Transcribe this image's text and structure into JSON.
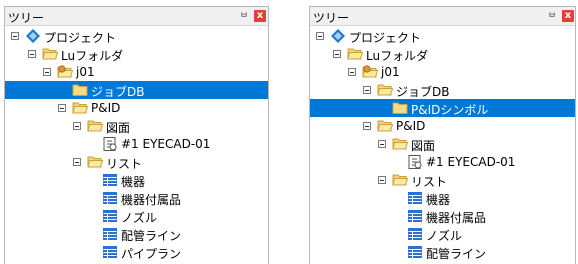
{
  "panels": [
    {
      "title": "ツリー",
      "pin_glyph": "ㅂ",
      "close_glyph": "x",
      "items": [
        {
          "label": "プロジェクト",
          "icon": "project-icon",
          "expander": true
        },
        {
          "label": "Luフォルダ",
          "icon": "folder-open-icon",
          "expander": true
        },
        {
          "label": "j01",
          "icon": "job-folder-icon",
          "expander": true
        },
        {
          "label": "ジョブDB",
          "icon": "folder-closed-icon",
          "expander": false,
          "selected": true
        },
        {
          "label": "P&ID",
          "icon": "folder-open-icon",
          "expander": true
        },
        {
          "label": "図面",
          "icon": "folder-open-icon",
          "expander": true
        },
        {
          "label": "#1 EYECAD-01",
          "icon": "drawing-icon",
          "expander": false
        },
        {
          "label": "リスト",
          "icon": "folder-open-icon",
          "expander": true
        },
        {
          "label": "機器",
          "icon": "table-icon",
          "expander": false
        },
        {
          "label": "機器付属品",
          "icon": "table-icon",
          "expander": false
        },
        {
          "label": "ノズル",
          "icon": "table-icon",
          "expander": false
        },
        {
          "label": "配管ライン",
          "icon": "table-icon",
          "expander": false
        },
        {
          "label": "パイプラン",
          "icon": "table-icon",
          "expander": false
        }
      ]
    },
    {
      "title": "ツリー",
      "pin_glyph": "ㅂ",
      "close_glyph": "x",
      "items": [
        {
          "label": "プロジェクト",
          "icon": "project-icon",
          "expander": true
        },
        {
          "label": "Luフォルダ",
          "icon": "folder-open-icon",
          "expander": true
        },
        {
          "label": "j01",
          "icon": "job-folder-icon",
          "expander": true
        },
        {
          "label": "ジョブDB",
          "icon": "folder-open-icon",
          "expander": true
        },
        {
          "label": "P&IDシンボル",
          "icon": "folder-closed-icon",
          "expander": false,
          "selected": true
        },
        {
          "label": "P&ID",
          "icon": "folder-open-icon",
          "expander": true
        },
        {
          "label": "図面",
          "icon": "folder-open-icon",
          "expander": true
        },
        {
          "label": "#1 EYECAD-01",
          "icon": "drawing-icon",
          "expander": false
        },
        {
          "label": "リスト",
          "icon": "folder-open-icon",
          "expander": true
        },
        {
          "label": "機器",
          "icon": "table-icon",
          "expander": false
        },
        {
          "label": "機器付属品",
          "icon": "table-icon",
          "expander": false
        },
        {
          "label": "ノズル",
          "icon": "table-icon",
          "expander": false
        },
        {
          "label": "配管ライン",
          "icon": "table-icon",
          "expander": false
        }
      ]
    }
  ],
  "colors": {
    "selection": "#0078d7",
    "close_button": "#e0413b",
    "folder": "#f5d27a",
    "table_icon": "#2e6fd2",
    "project_icon": "#1f77c9"
  }
}
